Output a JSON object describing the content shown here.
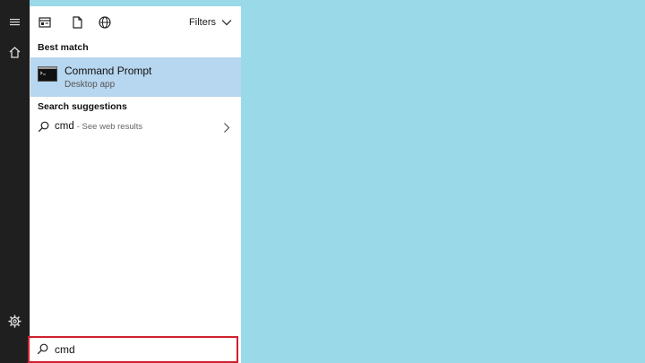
{
  "rail": {
    "icons": [
      "hamburger-icon",
      "home-icon",
      "gear-icon"
    ]
  },
  "topbar": {
    "icons": [
      "apps-icon",
      "documents-icon",
      "web-globe-icon"
    ],
    "filters_label": "Filters"
  },
  "best_match": {
    "heading": "Best match",
    "title": "Command Prompt",
    "subtitle": "Desktop app",
    "icon": "command-prompt-icon"
  },
  "suggestions": {
    "heading": "Search suggestions",
    "items": [
      {
        "query": "cmd",
        "hint": "- See web results"
      }
    ]
  },
  "search": {
    "value": "cmd",
    "placeholder": ""
  },
  "colors": {
    "desktop": "#99d9e8",
    "rail": "#1f1f1f",
    "selected": "#b7d6ef",
    "search_border": "#d0202e"
  }
}
